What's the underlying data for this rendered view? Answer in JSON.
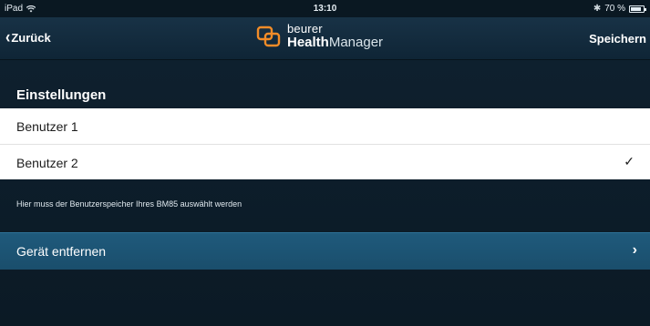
{
  "status_bar": {
    "device": "iPad",
    "wifi_icon": "wifi-icon",
    "time": "13:10",
    "bluetooth_icon": "bluetooth-icon",
    "battery": "70 %"
  },
  "nav": {
    "back_label": "Zurück",
    "brand": "beurer",
    "product_bold": "Health",
    "product_rest": "Manager",
    "save_label": "Speichern"
  },
  "settings": {
    "title": "Einstellungen",
    "users": [
      {
        "label": "Benutzer 1",
        "selected": false
      },
      {
        "label": "Benutzer 2",
        "selected": true
      }
    ],
    "checkmark": "✓",
    "hint": "Hier muss der Benutzerspeicher Ihres BM85 auswählt werden"
  },
  "remove": {
    "label": "Gerät entfernen",
    "chevron": "›"
  },
  "colors": {
    "background": "#0d1c28",
    "nav_bar": "#183246",
    "remove_row": "#1f5a7c",
    "logo_accent": "#f28c28"
  }
}
